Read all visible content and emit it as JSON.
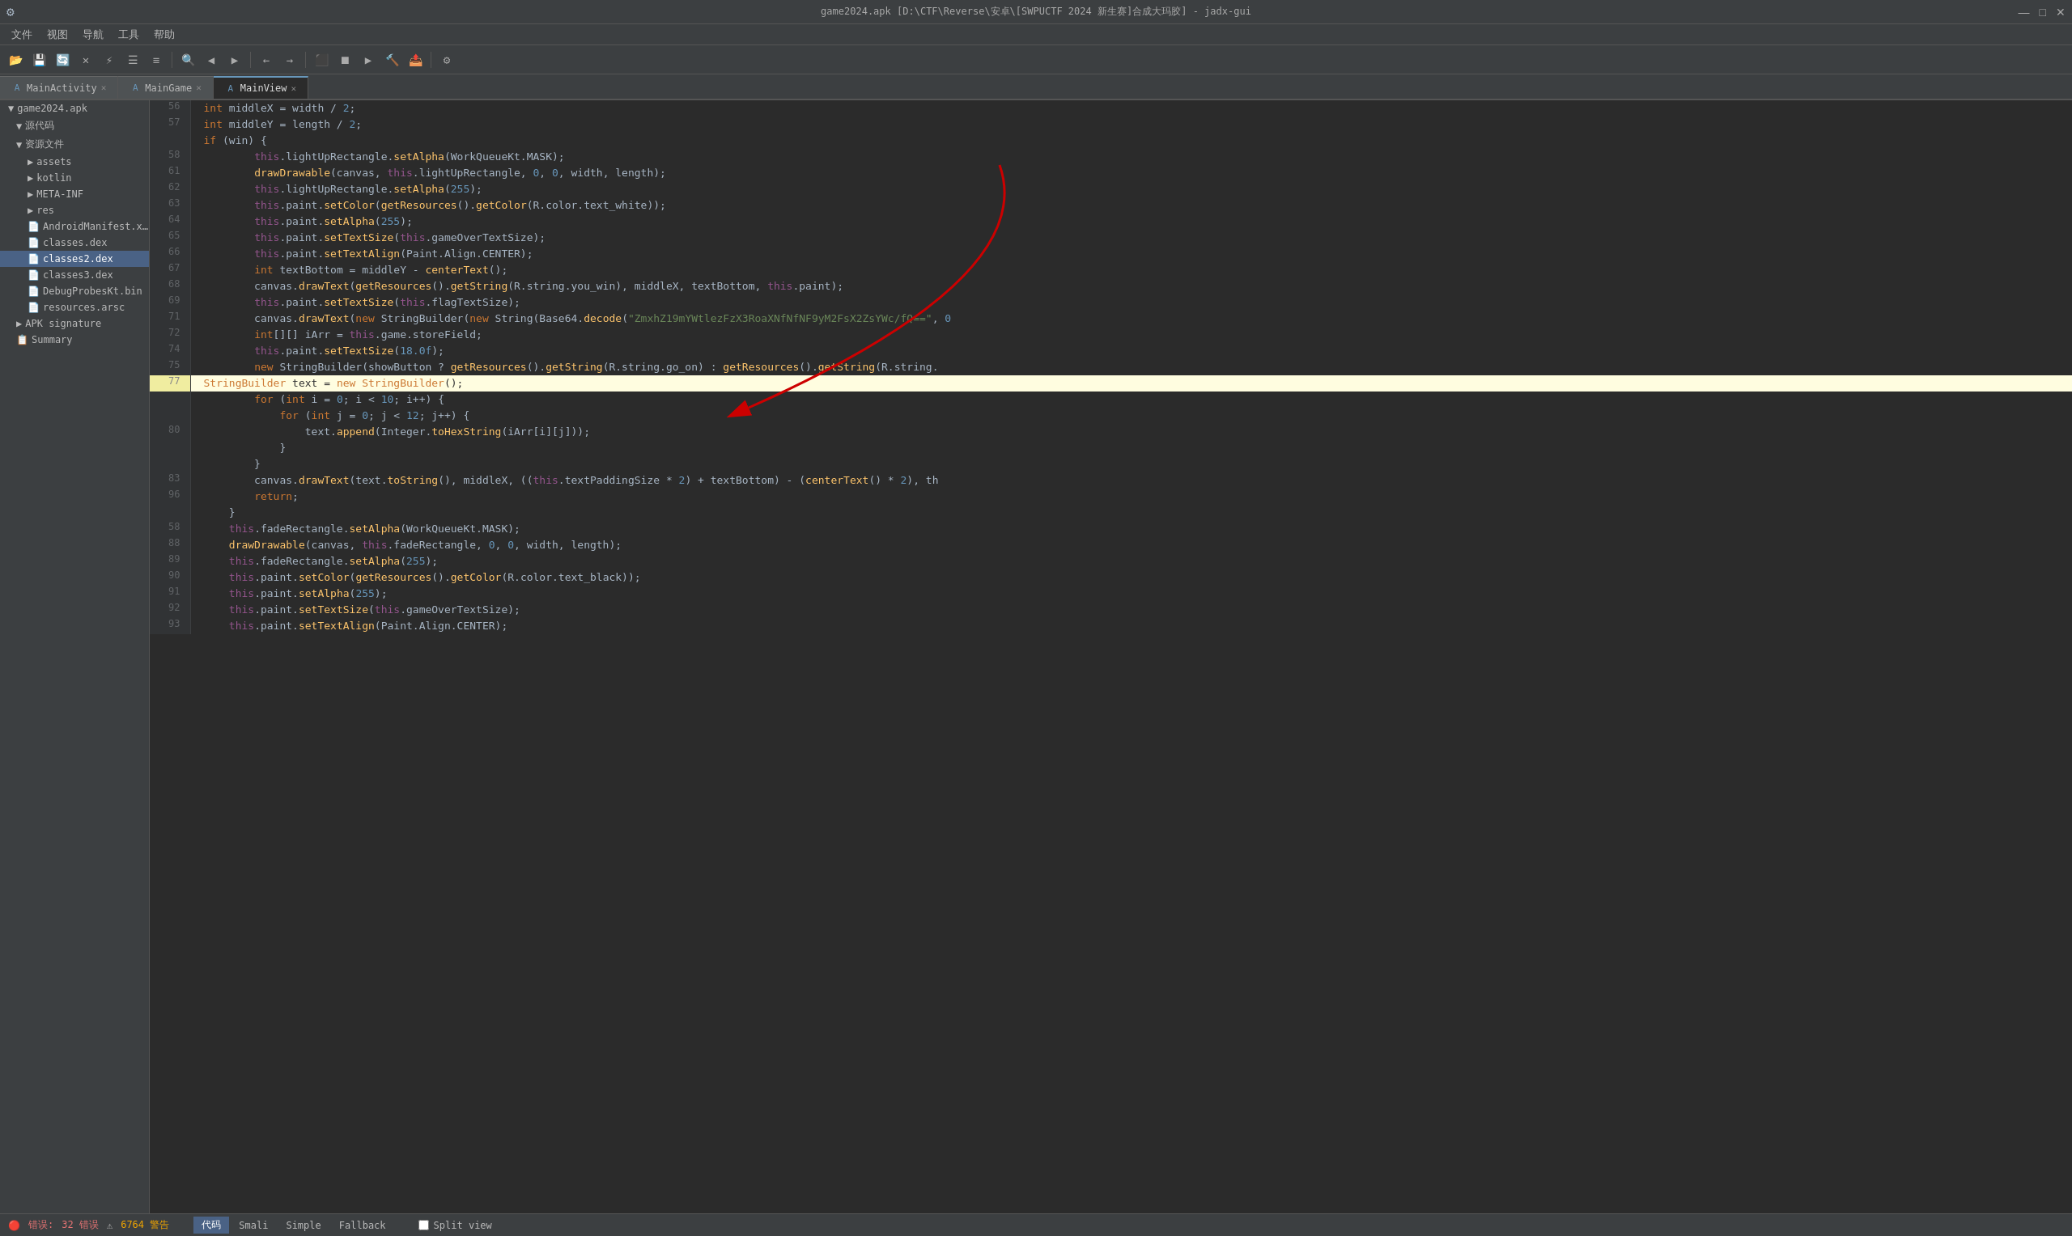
{
  "titlebar": {
    "title": "game2024.apk [D:\\CTF\\Reverse\\安卓\\[SWPUCTF 2024 新生赛]合成大玛胶] - jadx-gui",
    "minimize": "—",
    "maximize": "□",
    "close": "✕"
  },
  "menubar": {
    "items": [
      "文件",
      "视图",
      "导航",
      "工具",
      "帮助"
    ]
  },
  "tabs": [
    {
      "label": "MainActivity",
      "active": false,
      "closable": true,
      "icon": "A"
    },
    {
      "label": "MainGame",
      "active": false,
      "closable": true,
      "icon": "A"
    },
    {
      "label": "MainView",
      "active": true,
      "closable": true,
      "icon": "A"
    }
  ],
  "sidebar": {
    "root_label": "game2024.apk",
    "items": [
      {
        "label": "源代码",
        "level": 1,
        "expanded": true,
        "type": "folder"
      },
      {
        "label": "资源文件",
        "level": 1,
        "expanded": true,
        "type": "folder"
      },
      {
        "label": "assets",
        "level": 2,
        "expanded": false,
        "type": "folder"
      },
      {
        "label": "kotlin",
        "level": 2,
        "expanded": false,
        "type": "folder"
      },
      {
        "label": "META-INF",
        "level": 2,
        "expanded": false,
        "type": "folder"
      },
      {
        "label": "res",
        "level": 2,
        "expanded": false,
        "type": "folder"
      },
      {
        "label": "AndroidManifest.x…",
        "level": 2,
        "type": "file"
      },
      {
        "label": "classes.dex",
        "level": 2,
        "type": "file"
      },
      {
        "label": "classes2.dex",
        "level": 2,
        "type": "file",
        "selected": true
      },
      {
        "label": "classes3.dex",
        "level": 2,
        "type": "file"
      },
      {
        "label": "DebugProbesKt.bin",
        "level": 2,
        "type": "file"
      },
      {
        "label": "resources.arsc",
        "level": 2,
        "type": "file"
      },
      {
        "label": "APK signature",
        "level": 1,
        "type": "folder"
      },
      {
        "label": "Summary",
        "level": 1,
        "type": "item"
      }
    ]
  },
  "code": {
    "lines": [
      {
        "num": 56,
        "content": "    int middleX = width / 2;"
      },
      {
        "num": 57,
        "content": "    int middleY = length / 2;"
      },
      {
        "num": "",
        "content": "    if (win) {"
      },
      {
        "num": 58,
        "content": "        this.lightUpRectangle.setAlpha(WorkQueueKt.MASK);"
      },
      {
        "num": 61,
        "content": "        drawDrawable(canvas, this.lightUpRectangle, 0, 0, width, length);"
      },
      {
        "num": 62,
        "content": "        this.lightUpRectangle.setAlpha(255);"
      },
      {
        "num": 63,
        "content": "        this.paint.setColor(getResources().getColor(R.color.text_white));"
      },
      {
        "num": 64,
        "content": "        this.paint.setAlpha(255);"
      },
      {
        "num": 65,
        "content": "        this.paint.setTextSize(this.gameOverTextSize);"
      },
      {
        "num": 66,
        "content": "        this.paint.setTextAlign(Paint.Align.CENTER);"
      },
      {
        "num": 67,
        "content": "        int textBottom = middleY - centerText();"
      },
      {
        "num": 68,
        "content": "        canvas.drawText(getResources().getString(R.string.you_win), middleX, textBottom, this.paint);"
      },
      {
        "num": 69,
        "content": "        this.paint.setTextSize(this.flagTextSize);"
      },
      {
        "num": 71,
        "content": "        canvas.drawText(new StringBuilder(new String(Base64.decode(\"ZmxhZ19mYWtlezFzX3RoaXNfNfNF9yM2FsX2ZsYWc/fQ==\", 0"
      },
      {
        "num": 72,
        "content": "        int[][] iArr = this.game.storeField;"
      },
      {
        "num": 74,
        "content": "        this.paint.setTextSize(18.0f);"
      },
      {
        "num": 75,
        "content": "        new StringBuilder(showButton ? getResources().getString(R.string.go_on) : getResources().getString(R.string."
      },
      {
        "num": 77,
        "content": "        StringBuilder text = new StringBuilder();",
        "highlighted": true
      },
      {
        "num": "",
        "content": "        for (int i = 0; i < 10; i++) {"
      },
      {
        "num": "",
        "content": "            for (int j = 0; j < 12; j++) {"
      },
      {
        "num": 80,
        "content": "                text.append(Integer.toHexString(iArr[i][j]));"
      },
      {
        "num": "",
        "content": "            }"
      },
      {
        "num": "",
        "content": "        }"
      },
      {
        "num": 83,
        "content": "        canvas.drawText(text.toString(), middleX, ((this.textPaddingSize * 2) + textBottom) - (centerText() * 2), th"
      },
      {
        "num": 96,
        "content": "        return;"
      },
      {
        "num": "",
        "content": "    }"
      },
      {
        "num": 58,
        "content": "    this.fadeRectangle.setAlpha(WorkQueueKt.MASK);"
      },
      {
        "num": 88,
        "content": "    drawDrawable(canvas, this.fadeRectangle, 0, 0, width, length);"
      },
      {
        "num": 89,
        "content": "    this.fadeRectangle.setAlpha(255);"
      },
      {
        "num": 90,
        "content": "    this.paint.setColor(getResources().getColor(R.color.text_black));"
      },
      {
        "num": 91,
        "content": "    this.paint.setAlpha(255);"
      },
      {
        "num": 92,
        "content": "    this.paint.setTextSize(this.gameOverTextSize);"
      },
      {
        "num": 93,
        "content": "    this.paint.setTextAlign(Paint.Align.CENTER);"
      }
    ]
  },
  "statusbar": {
    "errors_label": "错误:",
    "errors_count": "32 错误",
    "warnings_count": "6764 警告",
    "tabs": [
      "代码",
      "Smali",
      "Simple",
      "Fallback"
    ],
    "split_view_label": "Split view",
    "active_tab": "代码"
  }
}
